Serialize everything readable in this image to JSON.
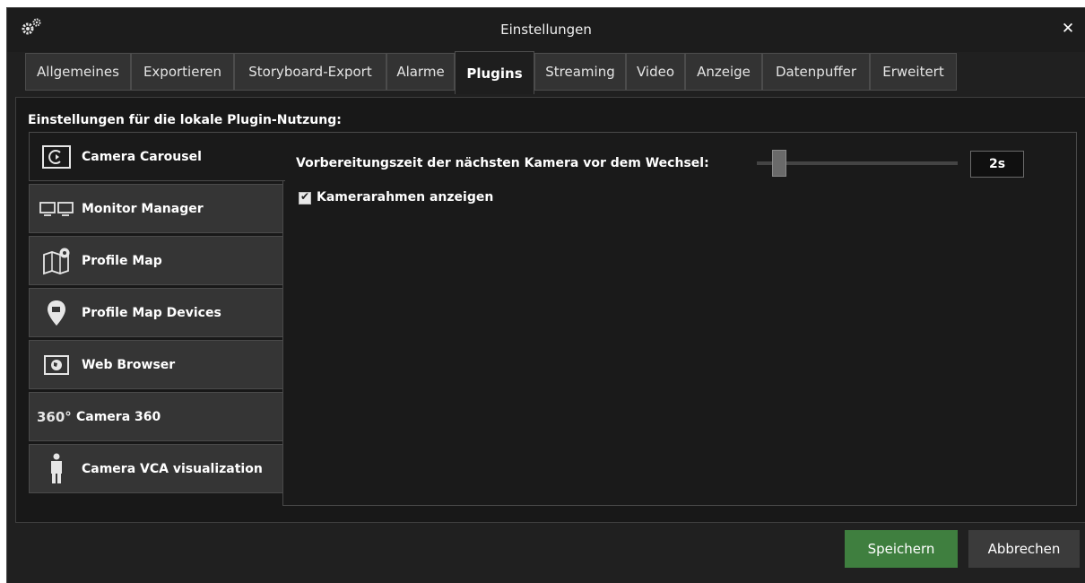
{
  "window": {
    "title": "Einstellungen",
    "close_label": "✕"
  },
  "tabs": [
    {
      "label": "Allgemeines"
    },
    {
      "label": "Exportieren"
    },
    {
      "label": "Storyboard-Export"
    },
    {
      "label": "Alarme"
    },
    {
      "label": "Plugins",
      "active": true
    },
    {
      "label": "Streaming"
    },
    {
      "label": "Video"
    },
    {
      "label": "Anzeige"
    },
    {
      "label": "Datenpuffer"
    },
    {
      "label": "Erweitert"
    }
  ],
  "section_heading": "Einstellungen für die lokale Plugin-Nutzung:",
  "plugins": [
    {
      "label": "Camera Carousel",
      "icon": "carousel-icon",
      "active": true
    },
    {
      "label": "Monitor Manager",
      "icon": "monitor-icon"
    },
    {
      "label": "Profile Map",
      "icon": "map-icon"
    },
    {
      "label": "Profile Map Devices",
      "icon": "map-pin-icon"
    },
    {
      "label": "Web Browser",
      "icon": "globe-icon"
    },
    {
      "label": "Camera 360",
      "icon": "camera-360-icon",
      "icon_text": "360°"
    },
    {
      "label": "Camera VCA visualization",
      "icon": "person-icon"
    }
  ],
  "carousel_settings": {
    "switch_prep_label": "Vorbereitungszeit der nächsten Kamera vor dem Wechsel:",
    "switch_prep_value": "2s",
    "slider_fraction": 0.1,
    "show_frame_label": "Kamerarahmen anzeigen",
    "show_frame_checked": true
  },
  "footer": {
    "save_label": "Speichern",
    "cancel_label": "Abbrechen"
  },
  "colors": {
    "save_button": "#3f7f3f",
    "window_bg": "#202020",
    "panel_bg": "#1a1a1a"
  }
}
